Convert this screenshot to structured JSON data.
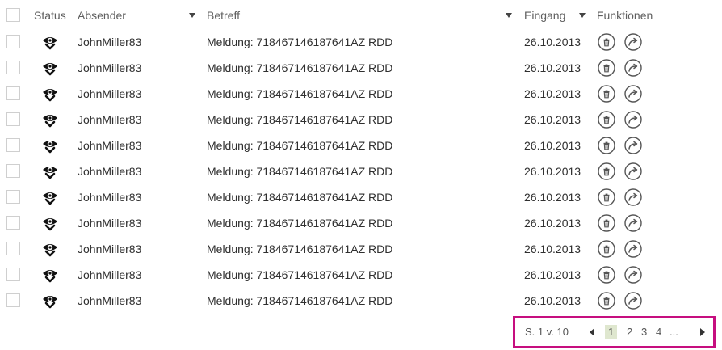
{
  "header": {
    "status": "Status",
    "absender": "Absender",
    "betreff": "Betreff",
    "eingang": "Eingang",
    "funktionen": "Funktionen"
  },
  "rows": [
    {
      "absender": "JohnMiller83",
      "betreff": "Meldung: 718467146187641AZ RDD",
      "eingang": "26.10.2013",
      "status_icon": "read-eye-icon"
    },
    {
      "absender": "JohnMiller83",
      "betreff": "Meldung: 718467146187641AZ RDD",
      "eingang": "26.10.2013",
      "status_icon": "read-eye-icon"
    },
    {
      "absender": "JohnMiller83",
      "betreff": "Meldung: 718467146187641AZ RDD",
      "eingang": "26.10.2013",
      "status_icon": "read-eye-icon"
    },
    {
      "absender": "JohnMiller83",
      "betreff": "Meldung: 718467146187641AZ RDD",
      "eingang": "26.10.2013",
      "status_icon": "read-eye-icon"
    },
    {
      "absender": "JohnMiller83",
      "betreff": "Meldung: 718467146187641AZ RDD",
      "eingang": "26.10.2013",
      "status_icon": "read-eye-icon"
    },
    {
      "absender": "JohnMiller83",
      "betreff": "Meldung: 718467146187641AZ RDD",
      "eingang": "26.10.2013",
      "status_icon": "read-eye-icon"
    },
    {
      "absender": "JohnMiller83",
      "betreff": "Meldung: 718467146187641AZ RDD",
      "eingang": "26.10.2013",
      "status_icon": "read-eye-icon"
    },
    {
      "absender": "JohnMiller83",
      "betreff": "Meldung: 718467146187641AZ RDD",
      "eingang": "26.10.2013",
      "status_icon": "read-eye-icon"
    },
    {
      "absender": "JohnMiller83",
      "betreff": "Meldung: 718467146187641AZ RDD",
      "eingang": "26.10.2013",
      "status_icon": "read-eye-icon"
    },
    {
      "absender": "JohnMiller83",
      "betreff": "Meldung: 718467146187641AZ RDD",
      "eingang": "26.10.2013",
      "status_icon": "read-eye-icon"
    },
    {
      "absender": "JohnMiller83",
      "betreff": "Meldung: 718467146187641AZ RDD",
      "eingang": "26.10.2013",
      "status_icon": "read-eye-icon"
    }
  ],
  "pagination": {
    "summary": "S. 1 v. 10",
    "pages": [
      "1",
      "2",
      "3",
      "4"
    ],
    "current": "1",
    "ellipsis": "...",
    "highlight_color": "#c60e7f"
  },
  "icons": {
    "delete": "trash-icon",
    "forward": "forward-arrow-icon"
  }
}
